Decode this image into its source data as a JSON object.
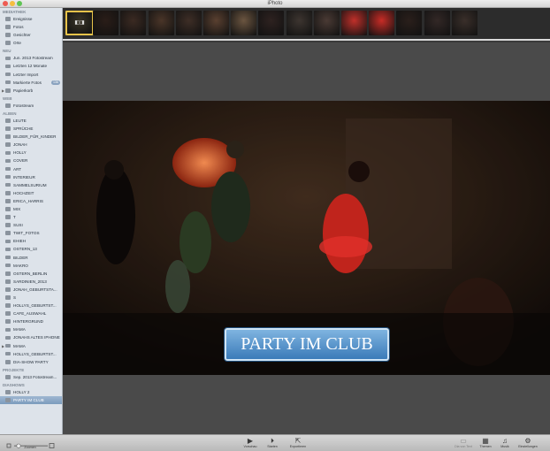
{
  "window": {
    "title": "iPhoto"
  },
  "sidebar": {
    "sections": [
      {
        "heading": "MEDIATHEK",
        "items": [
          {
            "label": "Ereignisse",
            "icon": "events-icon"
          },
          {
            "label": "Fotos",
            "icon": "photos-icon"
          },
          {
            "label": "Gesichter",
            "icon": "faces-icon"
          },
          {
            "label": "Orte",
            "icon": "places-icon"
          }
        ]
      },
      {
        "heading": "NEU",
        "items": [
          {
            "label": "Jun. 2013 Fotostream",
            "icon": "calendar-icon"
          },
          {
            "label": "Letzten 12 Monate",
            "icon": "calendar-icon"
          },
          {
            "label": "Letzter Import",
            "icon": "clock-icon"
          },
          {
            "label": "Markierte Fotos",
            "icon": "flag-icon",
            "badge": "136"
          },
          {
            "label": "Papierkorb",
            "icon": "trash-icon",
            "disclosure": "▶"
          }
        ]
      },
      {
        "heading": "WEB",
        "items": [
          {
            "label": "Fotostream",
            "icon": "photostream-icon"
          }
        ]
      },
      {
        "heading": "ALBEN",
        "items": [
          {
            "label": "LEUTE",
            "icon": "album-icon"
          },
          {
            "label": "SPRÜCHE",
            "icon": "album-icon"
          },
          {
            "label": "BILDER_FÜR_KINDER",
            "icon": "album-icon"
          },
          {
            "label": "JONAH",
            "icon": "album-icon"
          },
          {
            "label": "HOLLY",
            "icon": "album-icon"
          },
          {
            "label": "COVER",
            "icon": "album-icon"
          },
          {
            "label": "ART",
            "icon": "album-icon"
          },
          {
            "label": "INTERIEUR",
            "icon": "album-icon"
          },
          {
            "label": "SAMMELSURIUM",
            "icon": "album-icon"
          },
          {
            "label": "HOCHZEIT",
            "icon": "album-icon"
          },
          {
            "label": "ERICA_HARRIS",
            "icon": "album-icon"
          },
          {
            "label": "MIX",
            "icon": "album-icon"
          },
          {
            "label": "T",
            "icon": "album-icon"
          },
          {
            "label": "SUSI",
            "icon": "album-icon"
          },
          {
            "label": "TWIT_FOTOS",
            "icon": "album-icon"
          },
          {
            "label": "EHIEH",
            "icon": "album-icon"
          },
          {
            "label": "OSTERN_13",
            "icon": "album-icon"
          },
          {
            "label": "BILDER",
            "icon": "album-icon"
          },
          {
            "label": "MAKRO",
            "icon": "album-icon"
          },
          {
            "label": "OSTERN_BERLIN",
            "icon": "album-icon"
          },
          {
            "label": "SARDINIEN_2013",
            "icon": "album-icon"
          },
          {
            "label": "JONAH_GEBURTSTA...",
            "icon": "album-icon"
          },
          {
            "label": "S",
            "icon": "album-icon"
          },
          {
            "label": "HOLLYS_GEBURTST...",
            "icon": "album-icon"
          },
          {
            "label": "CAFE_AUSWAHL",
            "icon": "album-icon"
          },
          {
            "label": "HINTERGRUND",
            "icon": "album-icon"
          },
          {
            "label": "MAMA",
            "icon": "album-icon"
          },
          {
            "label": "JONAHS ALTES IPHONE",
            "icon": "album-icon"
          },
          {
            "label": "MAMA",
            "icon": "folder-icon",
            "disclosure": "▶"
          },
          {
            "label": "HOLLYS_GEBURTST...",
            "icon": "album-icon"
          },
          {
            "label": "DIA-SHOW PARTY",
            "icon": "album-icon"
          }
        ]
      },
      {
        "heading": "PROJEKTE",
        "items": [
          {
            "label": "Sep. 2013 Fotostream...",
            "icon": "project-icon"
          }
        ]
      },
      {
        "heading": "DIASHOWS",
        "items": [
          {
            "label": "HOLLY 2",
            "icon": "slideshow-icon"
          },
          {
            "label": "PARTY IM CLUB",
            "icon": "slideshow-icon",
            "selected": true
          }
        ]
      }
    ]
  },
  "filmstrip": {
    "thumbs": [
      {
        "color": "#3a3528",
        "selected": true,
        "label": "◧◨"
      },
      {
        "color": "#2a1d18"
      },
      {
        "color": "#3b2a22"
      },
      {
        "color": "#4a3528"
      },
      {
        "color": "#3e2e26"
      },
      {
        "color": "#5a4030"
      },
      {
        "color": "#6b5540"
      },
      {
        "color": "#2e2220"
      },
      {
        "color": "#3d3530"
      },
      {
        "color": "#4a3a34"
      },
      {
        "color": "#c0302a"
      },
      {
        "color": "#c82c26"
      },
      {
        "color": "#2a1f1b"
      },
      {
        "color": "#332826"
      },
      {
        "color": "#3a2f2a"
      }
    ]
  },
  "viewer": {
    "caption": "PARTY IM CLUB"
  },
  "toolbar": {
    "zoom_label": "Zoomen",
    "buttons": [
      {
        "label": "Vorschau",
        "icon": "preview-icon",
        "glyph": "▶",
        "enabled": true
      },
      {
        "label": "Starten",
        "icon": "play-icon",
        "glyph": "⏵",
        "enabled": true
      },
      {
        "label": "Exportieren",
        "icon": "export-icon",
        "glyph": "⇱",
        "enabled": true
      }
    ],
    "right_buttons": [
      {
        "label": "Dia von Text",
        "icon": "text-slide-icon",
        "glyph": "▭",
        "enabled": false
      },
      {
        "label": "Themen",
        "icon": "themes-icon",
        "glyph": "▦",
        "enabled": true
      },
      {
        "label": "Musik",
        "icon": "music-icon",
        "glyph": "♫",
        "enabled": true
      },
      {
        "label": "Einstellungen",
        "icon": "gear-icon",
        "glyph": "⚙",
        "enabled": true
      }
    ]
  }
}
